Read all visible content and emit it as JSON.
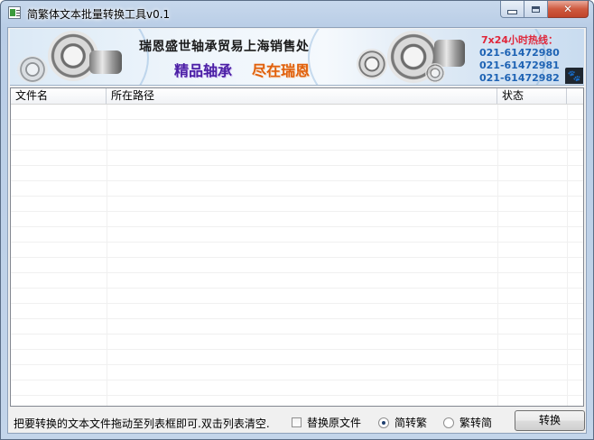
{
  "window": {
    "title": "简繁体文本批量转换工具v0.1",
    "close_glyph": "✕"
  },
  "banner": {
    "company": "瑞恩盛世轴承贸易上海销售处",
    "slogan_a": "精品轴承",
    "slogan_b": "尽在瑞恩",
    "hotline_title": "7x24小时热线：",
    "phones": [
      "021-61472980",
      "021-61472981",
      "021-61472982"
    ],
    "paw_glyph": "🐾"
  },
  "list": {
    "columns": [
      "文件名",
      "所在路径",
      "状态"
    ]
  },
  "footer": {
    "hint": "把要转换的文本文件拖动至列表框即可.双击列表清空.",
    "replace_original_label": "替换原文件",
    "replace_original_checked": false,
    "mode_s2t_label": "简转繁",
    "mode_t2s_label": "繁转简",
    "selected_mode": "简转繁",
    "convert_button": "转换"
  },
  "colors": {
    "slogan_a": "#4b1fa5",
    "slogan_b": "#e0600c",
    "hotline_title": "#e0263a",
    "hotline_numbers": "#1e63b4",
    "close_button": "#c0442a"
  }
}
